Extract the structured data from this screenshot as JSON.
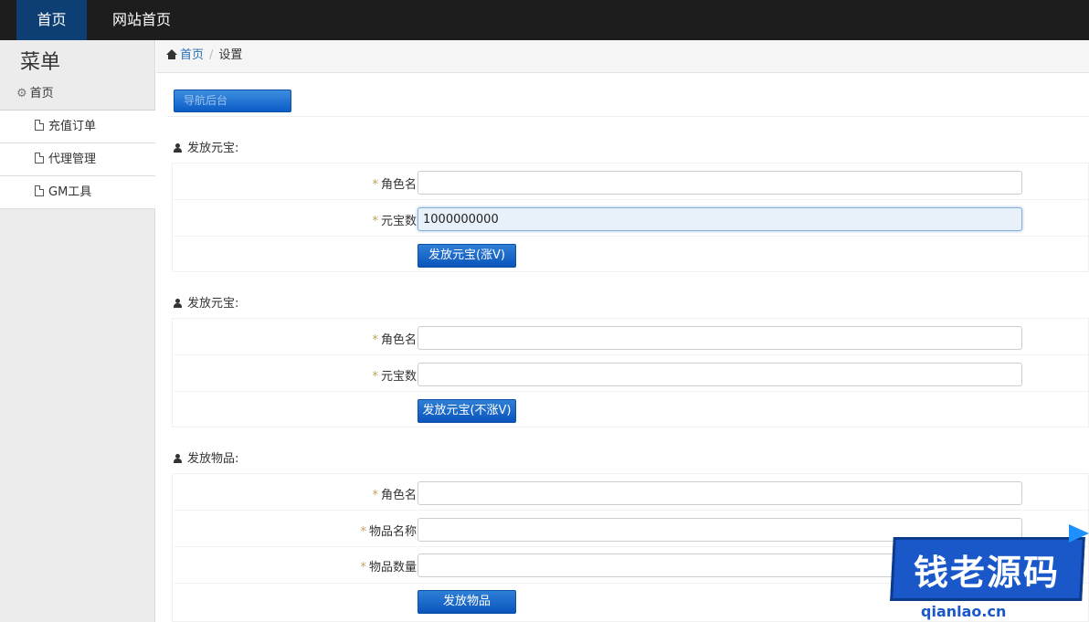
{
  "topbar": {
    "home_label": "首页",
    "site_label": "网站首页"
  },
  "sidebar": {
    "title": "菜单",
    "home_label": "首页",
    "items": [
      {
        "label": "充值订单"
      },
      {
        "label": "代理管理"
      },
      {
        "label": "GM工具"
      }
    ]
  },
  "breadcrumb": {
    "home": "首页",
    "current": "设置"
  },
  "top_button": {
    "label": "导航后台"
  },
  "sections": [
    {
      "title": "发放元宝:",
      "fields": [
        {
          "label": "角色名",
          "value": "",
          "placeholder": ""
        },
        {
          "label": "元宝数",
          "value": "1000000000",
          "placeholder": ""
        }
      ],
      "button": "发放元宝(涨V)"
    },
    {
      "title": "发放元宝:",
      "fields": [
        {
          "label": "角色名",
          "value": "",
          "placeholder": ""
        },
        {
          "label": "元宝数",
          "value": "",
          "placeholder": ""
        }
      ],
      "button": "发放元宝(不涨V)"
    },
    {
      "title": "发放物品:",
      "fields": [
        {
          "label": "角色名",
          "value": "",
          "placeholder": ""
        },
        {
          "label": "物品名称",
          "value": "",
          "placeholder": ""
        },
        {
          "label": "物品数量",
          "value": "",
          "placeholder": ""
        }
      ],
      "button": "发放物品"
    }
  ],
  "required_mark": "*",
  "watermark": {
    "text": "钱老源码",
    "url": "qianlao.cn"
  },
  "colors": {
    "topbar_bg": "#1d1d1d",
    "active_nav": "#0d3e74",
    "primary_button": "#0a55bd",
    "sidebar_bg": "#ececec"
  }
}
